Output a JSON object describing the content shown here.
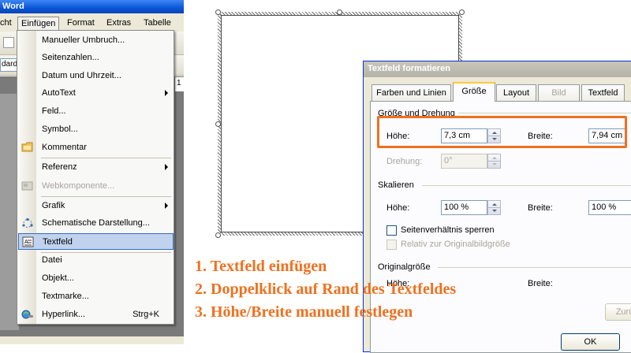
{
  "word": {
    "title": "Word",
    "menubar": [
      "cht",
      "Einfügen",
      "Format",
      "Extras",
      "Tabelle"
    ],
    "style_combo": "dard",
    "ruler_mark": "1"
  },
  "insert_menu": {
    "items": [
      {
        "label": "Manueller Umbruch...",
        "icon": "",
        "submenu": false,
        "disabled": false,
        "highlighted": false,
        "shortcut": ""
      },
      {
        "label": "Seitenzahlen...",
        "icon": "",
        "submenu": false,
        "disabled": false,
        "highlighted": false,
        "shortcut": ""
      },
      {
        "label": "Datum und Uhrzeit...",
        "icon": "",
        "submenu": false,
        "disabled": false,
        "highlighted": false,
        "shortcut": ""
      },
      {
        "label": "AutoText",
        "icon": "",
        "submenu": true,
        "disabled": false,
        "highlighted": false,
        "shortcut": ""
      },
      {
        "label": "Feld...",
        "icon": "",
        "submenu": false,
        "disabled": false,
        "highlighted": false,
        "shortcut": ""
      },
      {
        "label": "Symbol...",
        "icon": "",
        "submenu": false,
        "disabled": false,
        "highlighted": false,
        "shortcut": ""
      },
      {
        "label": "Kommentar",
        "icon": "comment-icon",
        "submenu": false,
        "disabled": false,
        "highlighted": false,
        "shortcut": ""
      },
      {
        "label": "Referenz",
        "icon": "",
        "submenu": true,
        "disabled": false,
        "highlighted": false,
        "shortcut": ""
      },
      {
        "label": "Webkomponente...",
        "icon": "web-component-icon",
        "submenu": false,
        "disabled": true,
        "highlighted": false,
        "shortcut": ""
      },
      {
        "label": "Grafik",
        "icon": "",
        "submenu": true,
        "disabled": false,
        "highlighted": false,
        "shortcut": ""
      },
      {
        "label": "Schematische Darstellung...",
        "icon": "diagram-icon",
        "submenu": false,
        "disabled": false,
        "highlighted": false,
        "shortcut": ""
      },
      {
        "label": "Textfeld",
        "icon": "textbox-icon",
        "submenu": false,
        "disabled": false,
        "highlighted": true,
        "shortcut": ""
      },
      {
        "label": "Datei",
        "icon": "",
        "submenu": false,
        "disabled": false,
        "highlighted": false,
        "shortcut": ""
      },
      {
        "label": "Objekt...",
        "icon": "",
        "submenu": false,
        "disabled": false,
        "highlighted": false,
        "shortcut": ""
      },
      {
        "label": "Textmarke...",
        "icon": "",
        "submenu": false,
        "disabled": false,
        "highlighted": false,
        "shortcut": ""
      },
      {
        "label": "Hyperlink...",
        "icon": "hyperlink-icon",
        "submenu": false,
        "disabled": false,
        "highlighted": false,
        "shortcut": "Strg+K"
      }
    ]
  },
  "dialog": {
    "title": "Textfeld formatieren",
    "tabs": [
      "Farben und Linien",
      "Größe",
      "Layout",
      "Bild",
      "Textfeld"
    ],
    "active_tab": "Größe",
    "size_group": {
      "title": "Größe und Drehung",
      "height_label": "Höhe:",
      "height_value": "7,3 cm",
      "width_label": "Breite:",
      "width_value": "7,94 cm",
      "rotation_label": "Drehung:",
      "rotation_value": "0°"
    },
    "scale_group": {
      "title": "Skalieren",
      "height_label": "Höhe:",
      "height_value": "100 %",
      "width_label": "Breite:",
      "width_value": "100 %",
      "lock_aspect": "Seitenverhältnis sperren",
      "relative_original": "Relativ zur Originalbildgröße"
    },
    "original_group": {
      "title": "Originalgröße",
      "height_label": "Höhe:",
      "width_label": "Breite:",
      "reset_button": "Zurü"
    },
    "ok_button": "OK"
  },
  "instructions": [
    "1. Textfeld einfügen",
    "2. Doppelklick auf Rand des Textfeldes",
    "3. Höhe/Breite manuell festlegen"
  ],
  "colors": {
    "accent": "#f0701e",
    "menu_highlight": "#c1d2ee",
    "titlebar": "#0a55d6"
  }
}
